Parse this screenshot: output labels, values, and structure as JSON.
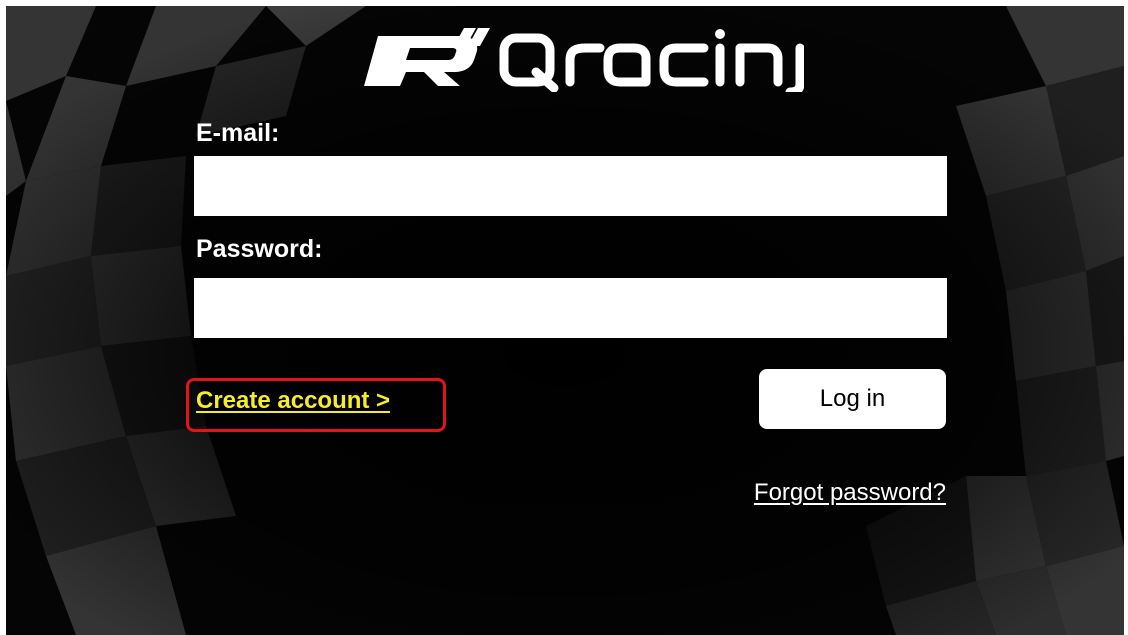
{
  "app": {
    "logo_alt": "RQracing"
  },
  "form": {
    "email_label": "E-mail:",
    "email_value": "",
    "email_placeholder": "",
    "password_label": "Password:",
    "password_value": "",
    "password_placeholder": "",
    "create_account_label": "Create account >",
    "login_label": "Log in",
    "forgot_password_label": "Forgot password?"
  },
  "icons": {
    "background": "checkered-flag-background",
    "logo": "rqracing-logo"
  },
  "colors": {
    "background": "#000000",
    "create_account_text": "#f5ec2a",
    "create_account_highlight": "#e0151b",
    "input_background": "#ffffff",
    "button_background": "#ffffff"
  }
}
